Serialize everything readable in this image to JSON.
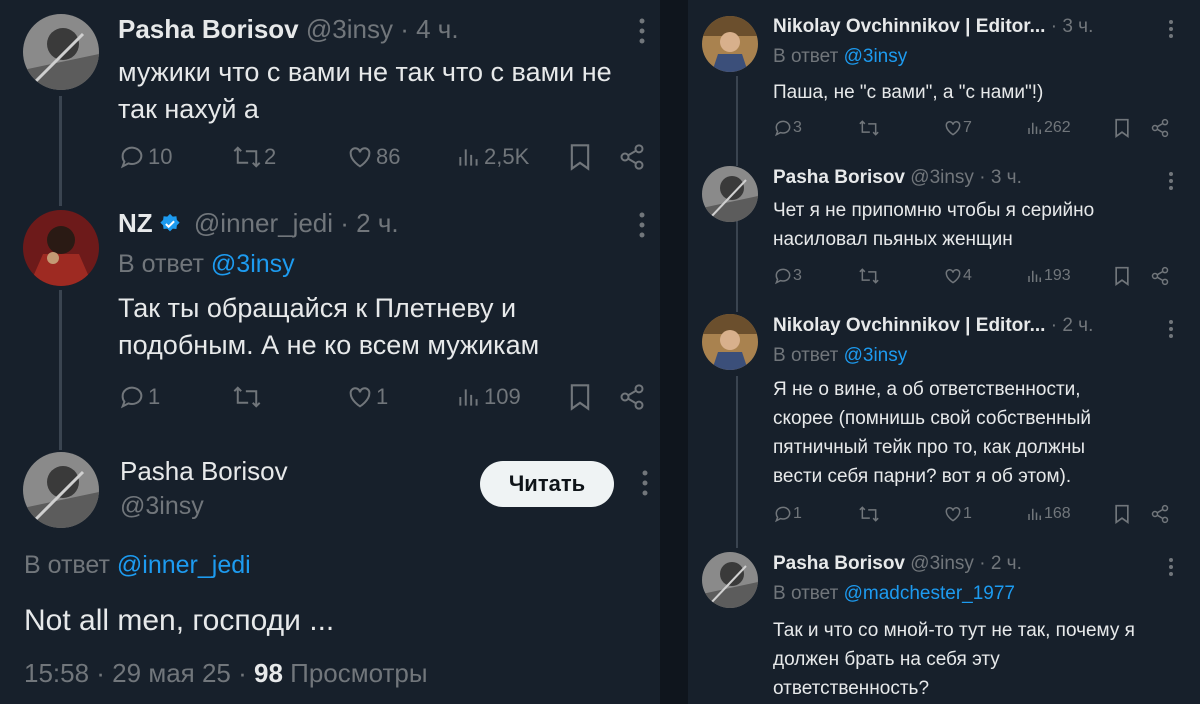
{
  "left": {
    "tweet1": {
      "name": "Pasha Borisov",
      "handle": "@3insy",
      "time": "· 4 ч.",
      "text_line1": "мужики что с вами не так что с вами не",
      "text_line2": "так нахуй а",
      "replies": "10",
      "retweets": "2",
      "likes": "86",
      "views": "2,5K"
    },
    "tweet2": {
      "name": "NZ",
      "handle": "@inner_jedi",
      "time": "· 2 ч.",
      "reply_prefix": "В ответ",
      "reply_to": "@3insy",
      "text_line1": "Так ты обращайся к Плетневу и",
      "text_line2": "подобным. А не ко всем мужикам",
      "replies": "1",
      "retweets": "",
      "likes": "1",
      "views": "109"
    },
    "tweet3": {
      "name": "Pasha Borisov",
      "handle": "@3insy",
      "follow_label": "Читать",
      "reply_prefix": "В ответ",
      "reply_to": "@inner_jedi",
      "text": "Not all men, господи ...",
      "time": "15:58 · 29 мая 25 ·",
      "views_count": "98",
      "views_label": "Просмотры"
    }
  },
  "right": {
    "tweet1": {
      "name": "Nikolay Ovchinnikov | Editor...",
      "time": "· 3 ч.",
      "reply_prefix": "В ответ",
      "reply_to": "@3insy",
      "text_line1": "Паша, не \"с вами\", а \"с нами\"!)",
      "replies": "3",
      "retweets": "",
      "likes": "7",
      "views": "262"
    },
    "tweet2": {
      "name": "Pasha Borisov",
      "handle": "@3insy",
      "time": "· 3 ч.",
      "text_line1": "Чет я не припомню чтобы я серийно",
      "text_line2": "насиловал пьяных женщин",
      "replies": "3",
      "retweets": "",
      "likes": "4",
      "views": "193"
    },
    "tweet3": {
      "name": "Nikolay Ovchinnikov | Editor...",
      "time": "· 2 ч.",
      "reply_prefix": "В ответ",
      "reply_to": "@3insy",
      "text_line1": "Я не о вине, а об ответственности,",
      "text_line2": "скорее (помнишь свой собственный",
      "text_line3": "пятничный тейк про то, как должны",
      "text_line4": "вести себя парни? вот я об этом).",
      "replies": "1",
      "retweets": "",
      "likes": "1",
      "views": "168"
    },
    "tweet4": {
      "name": "Pasha Borisov",
      "handle": "@3insy",
      "time": "· 2 ч.",
      "reply_prefix": "В ответ",
      "reply_to": "@madchester_1977",
      "text_line1": "Так и что со мной-то тут не так, почему я",
      "text_line2": "должен брать на себя эту",
      "text_line3": "ответственность?"
    }
  },
  "icons": {
    "reply": "speech-bubble-icon",
    "retweet": "retweet-icon",
    "like": "heart-icon",
    "views": "bar-chart-icon",
    "bookmark": "bookmark-icon",
    "share": "share-icon",
    "more": "vertical-dots-icon",
    "verified": "verified-badge-icon"
  },
  "colors": {
    "background": "#17202b",
    "text": "#e7e9ea",
    "muted": "#71767b",
    "link": "#1d9bf0",
    "button_bg": "#eff3f4"
  }
}
